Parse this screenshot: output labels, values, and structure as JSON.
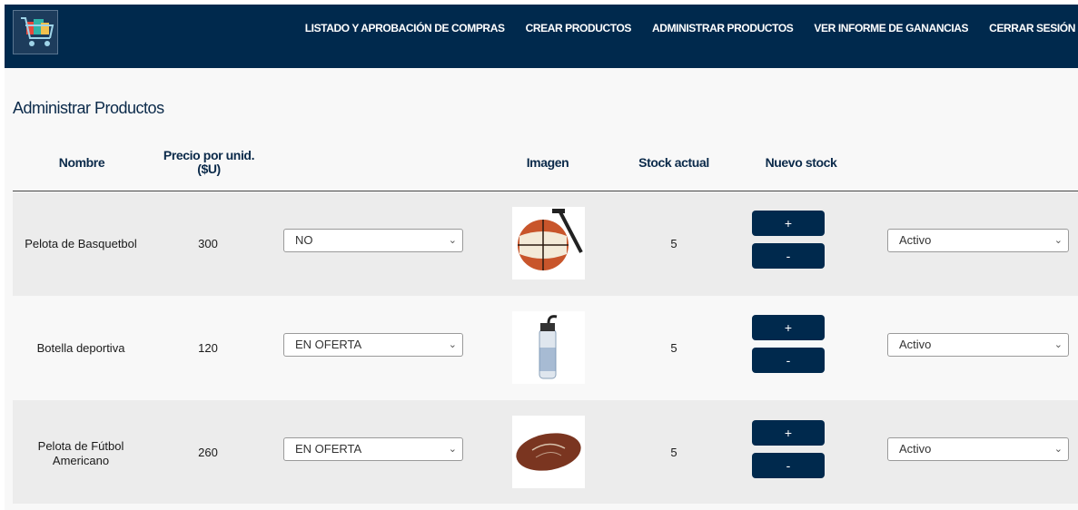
{
  "nav": {
    "links": [
      "LISTADO Y APROBACIÓN DE COMPRAS",
      "CREAR PRODUCTOS",
      "ADMINISTRAR PRODUCTOS",
      "VER INFORME DE GANANCIAS",
      "CERRAR SESIÓN"
    ]
  },
  "page": {
    "title": "Administrar Productos"
  },
  "table": {
    "headers": {
      "name": "Nombre",
      "price": "Precio por unid. ($U)",
      "image": "Imagen",
      "stock": "Stock actual",
      "new_stock": "Nuevo stock"
    },
    "increment_label": "+",
    "decrement_label": "-",
    "rows": [
      {
        "name": "Pelota de Basquetbol",
        "price": "300",
        "offer": "NO",
        "image_icon": "basketball-icon",
        "stock": "5",
        "status": "Activo"
      },
      {
        "name": "Botella deportiva",
        "price": "120",
        "offer": "EN OFERTA",
        "image_icon": "water-bottle-icon",
        "stock": "5",
        "status": "Activo"
      },
      {
        "name": "Pelota de Fútbol Americano",
        "price": "260",
        "offer": "EN OFERTA",
        "image_icon": "american-football-icon",
        "stock": "5",
        "status": "Activo"
      }
    ]
  },
  "colors": {
    "navbar": "#00294d",
    "button": "#00294d",
    "row_shade": "#ececec",
    "background": "#f8f8f8"
  }
}
